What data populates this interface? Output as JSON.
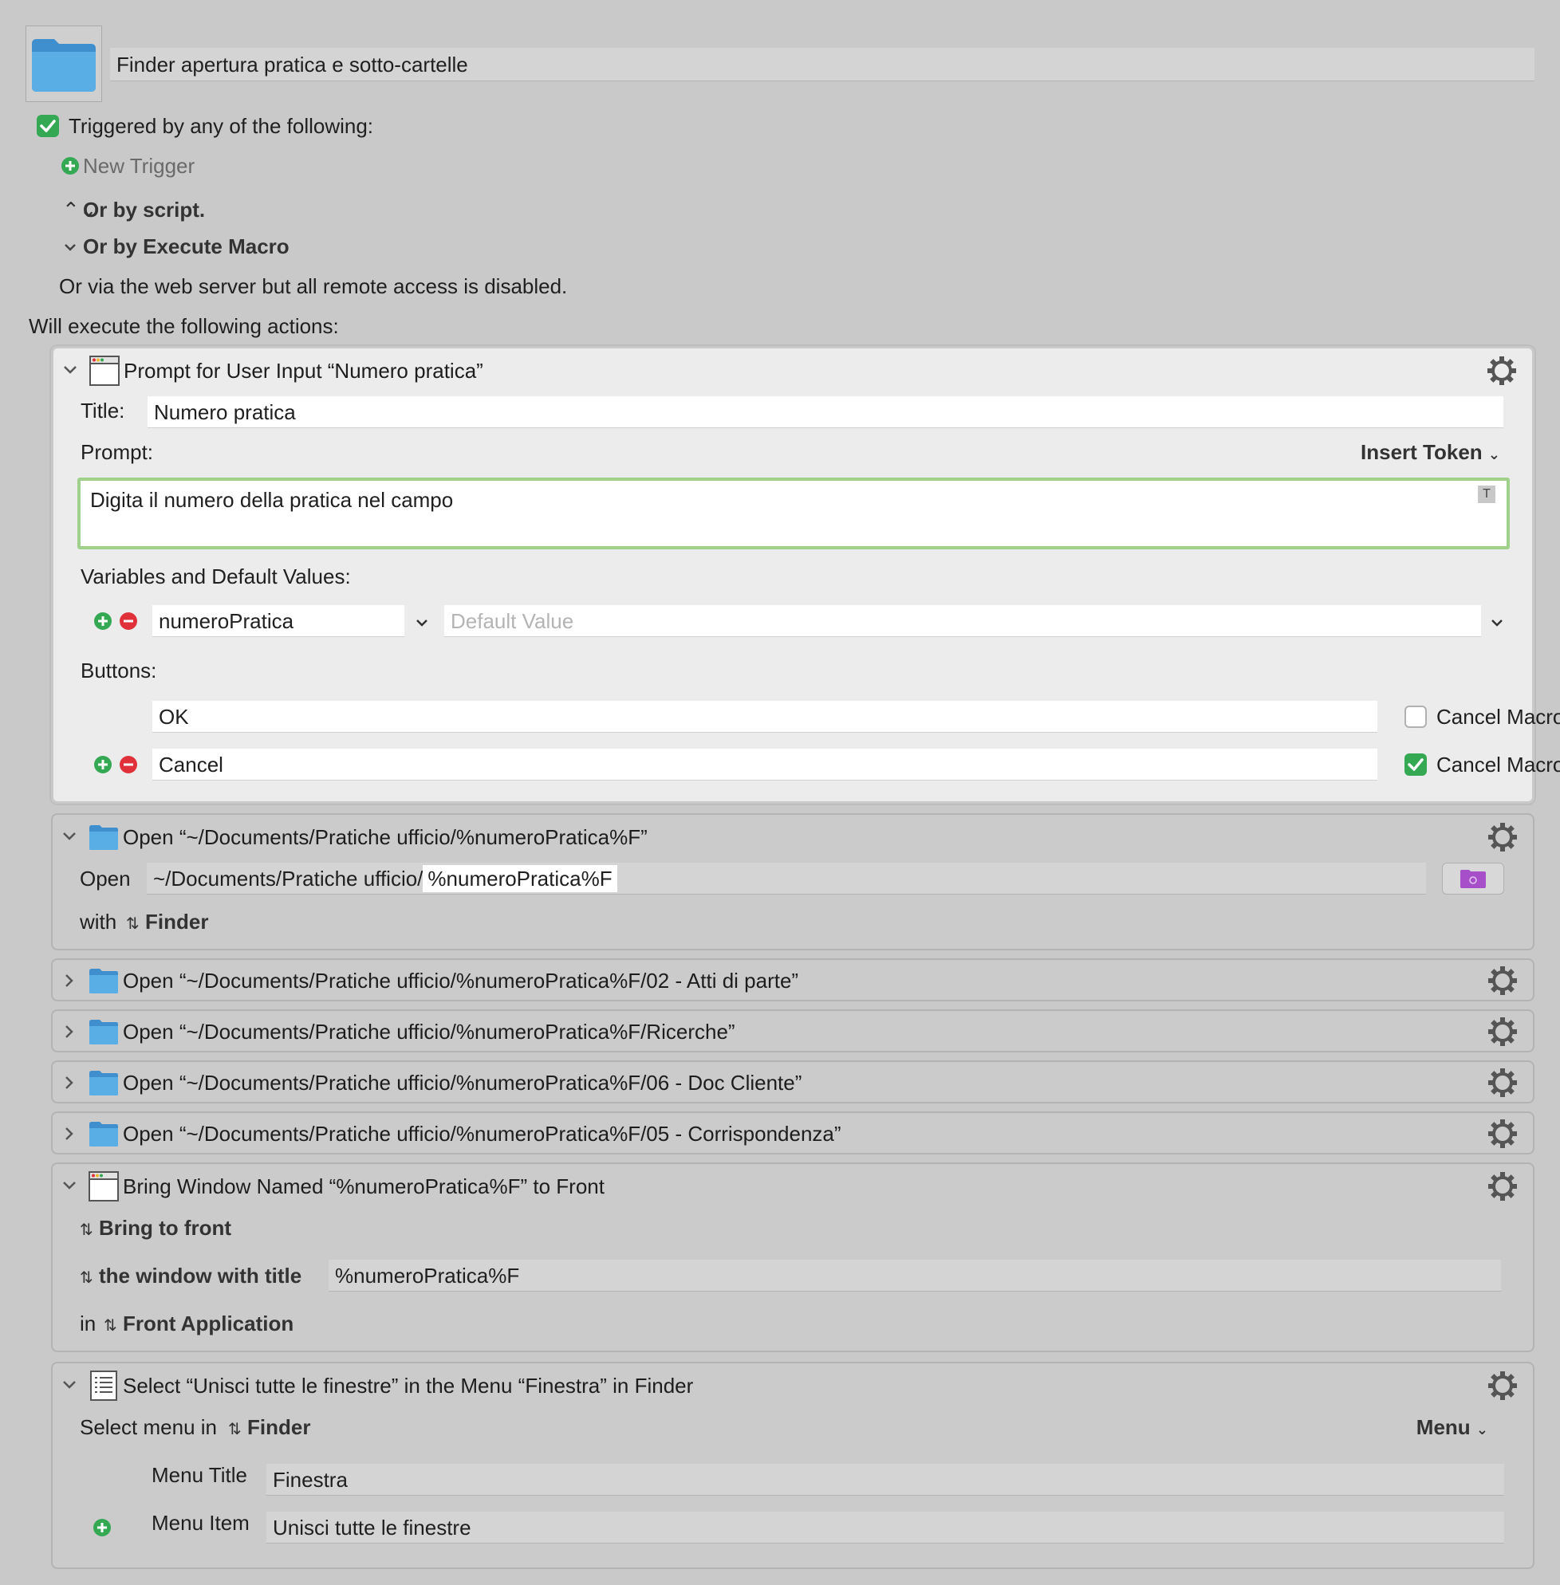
{
  "macro": {
    "name": "Finder apertura pratica e sotto-cartelle",
    "triggered_label": "Triggered by any of the following:",
    "new_trigger": "New Trigger",
    "or_by_script": "Or by script.",
    "or_by_execute": "Or by Execute Macro",
    "web_server": "Or via the web server but all remote access is disabled.",
    "will_execute": "Will execute the following actions:"
  },
  "prompt_action": {
    "title": "Prompt for User Input “Numero pratica”",
    "title_label": "Title:",
    "title_value": "Numero pratica",
    "prompt_label": "Prompt:",
    "insert_token": "Insert Token",
    "prompt_text": "Digita il numero della pratica nel campo",
    "token_badge": "T",
    "vars_label": "Variables and Default Values:",
    "var_name": "numeroPratica",
    "default_placeholder": "Default Value",
    "buttons_label": "Buttons:",
    "button1": "OK",
    "button2": "Cancel",
    "cancel_macro_label": "Cancel Macro"
  },
  "open_action": {
    "title": "Open “~/Documents/Pratiche ufficio/%numeroPratica%F”",
    "open_label": "Open",
    "path_prefix": "~/Documents/Pratiche ufficio/",
    "path_token": "%numeroPratica%F",
    "with_label": "with",
    "app": "Finder"
  },
  "collapsed_actions": [
    {
      "title": "Open “~/Documents/Pratiche ufficio/%numeroPratica%F/02 - Atti di parte”"
    },
    {
      "title": "Open “~/Documents/Pratiche ufficio/%numeroPratica%F/Ricerche”"
    },
    {
      "title": "Open “~/Documents/Pratiche ufficio/%numeroPratica%F/06 - Doc Cliente”"
    },
    {
      "title": "Open “~/Documents/Pratiche ufficio/%numeroPratica%F/05 - Corrispondenza”"
    }
  ],
  "bring_action": {
    "title": "Bring Window Named “%numeroPratica%F” to Front",
    "mode": "Bring to front",
    "match": "the window with title",
    "window_title": "%numeroPratica%F",
    "in_label": "in",
    "application": "Front Application"
  },
  "menu_action": {
    "title": "Select “Unisci tutte le finestre” in the Menu “Finestra” in Finder",
    "select_label": "Select menu in",
    "app": "Finder",
    "menu_button": "Menu",
    "menu_title_label": "Menu Title",
    "menu_title_value": "Finestra",
    "menu_item_label": "Menu Item",
    "menu_item_value": "Unisci tutte le finestre"
  },
  "colors": {
    "background": "#c9c9c9",
    "selected_block": "#ececec",
    "folder_blue": "#4a9fd8",
    "check_green": "#34a853",
    "remove_red": "#e0303a",
    "focus_ring": "#9fd18b"
  }
}
